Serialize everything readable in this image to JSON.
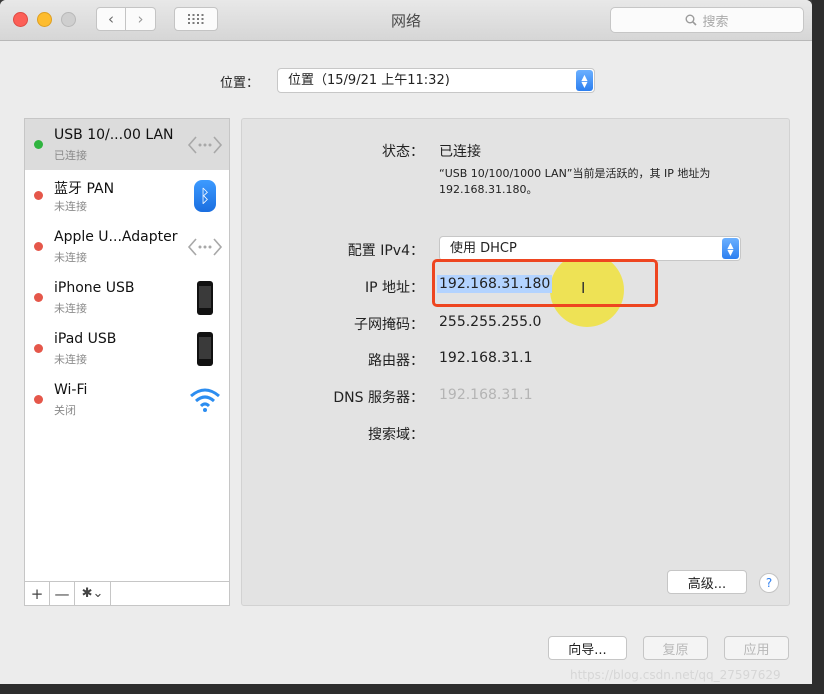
{
  "window": {
    "title": "网络"
  },
  "search": {
    "placeholder": "搜索"
  },
  "location": {
    "label": "位置：",
    "value": "位置（15/9/21 上午11:32)"
  },
  "services": [
    {
      "name": "USB 10/...00 LAN",
      "status": "已连接",
      "dot_color": "#2fb43f",
      "icon": "ethernet-icon",
      "selected": true
    },
    {
      "name": "蓝牙 PAN",
      "status": "未连接",
      "dot_color": "#e5574a",
      "icon": "bluetooth-icon"
    },
    {
      "name": "Apple U...Adapter",
      "status": "未连接",
      "dot_color": "#e5574a",
      "icon": "ethernet-icon"
    },
    {
      "name": "iPhone USB",
      "status": "未连接",
      "dot_color": "#e5574a",
      "icon": "iphone-icon"
    },
    {
      "name": "iPad USB",
      "status": "未连接",
      "dot_color": "#e5574a",
      "icon": "ipad-icon"
    },
    {
      "name": "Wi-Fi",
      "status": "关闭",
      "dot_color": "#e5574a",
      "icon": "wifi-icon"
    }
  ],
  "sidebar_bottom": {
    "add": "+",
    "remove": "—",
    "gear": "✱⌄"
  },
  "detail": {
    "status_label": "状态：",
    "status_value": "已连接",
    "description": "“USB 10/100/1000 LAN”当前是活跃的，其 IP 地址为 192.168.31.180。",
    "ipv4_label": "配置 IPv4：",
    "ipv4_value": "使用 DHCP",
    "ip_label": "IP 地址：",
    "ip_value": "192.168.31.180",
    "subnet_label": "子网掩码：",
    "subnet_value": "255.255.255.0",
    "router_label": "路由器：",
    "router_value": "192.168.31.1",
    "dns_label": "DNS 服务器：",
    "dns_value": "192.168.31.1",
    "search_domain_label": "搜索域："
  },
  "buttons": {
    "advanced": "高级...",
    "help": "?",
    "assistant": "向导...",
    "revert": "复原",
    "apply": "应用"
  },
  "watermark": "https://blog.csdn.net/qq_27597629",
  "colors": {
    "accent": "#2c7ff0",
    "annotation_red": "#ee4520",
    "annotation_yellow": "#f0e23c"
  }
}
